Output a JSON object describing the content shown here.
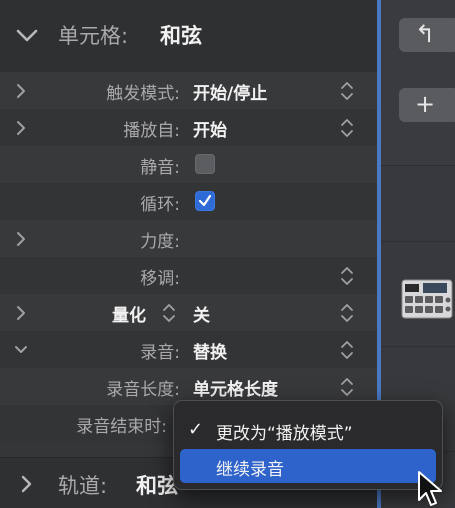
{
  "cell_section": {
    "label": "单元格:",
    "value": "和弦"
  },
  "rows": [
    {
      "label": "触发模式:",
      "value": "开始/停止"
    },
    {
      "label": "播放自:",
      "value": "开始"
    },
    {
      "label": "静音:",
      "checked": false
    },
    {
      "label": "循环:",
      "checked": true
    },
    {
      "label": "力度:"
    },
    {
      "label": "移调:"
    },
    {
      "label": "量化",
      "value": "关"
    },
    {
      "label": "录音:",
      "value": "替换"
    },
    {
      "label": "录音长度:",
      "value": "单元格长度"
    },
    {
      "label": "录音结束时:"
    }
  ],
  "track_section": {
    "label": "轨道:",
    "value": "和弦"
  },
  "toolbar": {
    "back_symbol": "↰",
    "add_symbol": "+"
  },
  "menu": {
    "items": [
      {
        "label": "更改为“播放模式”",
        "checked": true
      },
      {
        "label": "继续录音",
        "highlighted": true
      }
    ],
    "check_symbol": "✓"
  },
  "colors": {
    "accent": "#2f63cc",
    "panel": "#353638",
    "divider": "#4a79c4"
  },
  "icons": [
    "chevron-down-icon",
    "chevron-right-icon",
    "up-down-arrows-icon",
    "checkmark-icon",
    "drum-sampler-icon",
    "pointer-cursor-icon"
  ]
}
